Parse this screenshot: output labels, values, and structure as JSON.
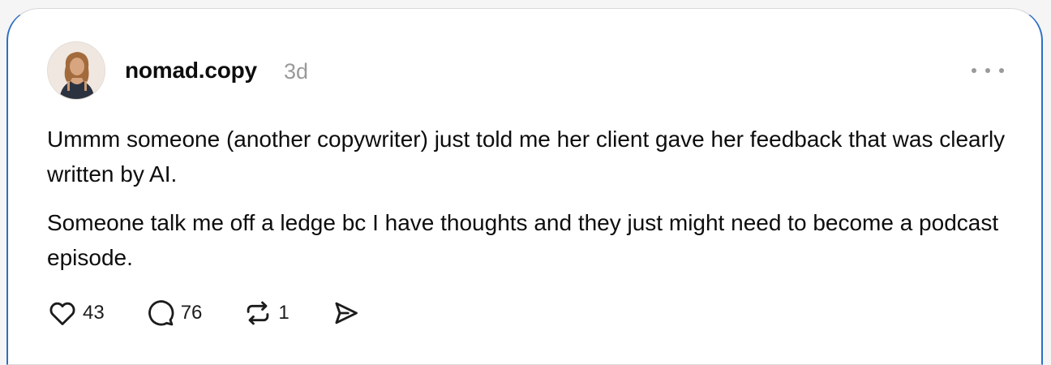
{
  "post": {
    "username": "nomad.copy",
    "timestamp": "3d",
    "paragraphs": [
      "Ummm someone (another copywriter) just told me her client gave her feedback that was clearly written by AI.",
      "Someone talk me off a ledge bc I have thoughts and they just might need to become a podcast episode."
    ],
    "actions": {
      "likes": "43",
      "replies": "76",
      "reposts": "1"
    }
  },
  "icons": {
    "more": "more-options-icon",
    "like": "heart-icon",
    "reply": "comment-bubble-icon",
    "repost": "repost-icon",
    "share": "send-icon"
  },
  "colors": {
    "text": "#0d0d0d",
    "muted": "#9a9a9a",
    "card_edge": "#2d6fc4"
  }
}
